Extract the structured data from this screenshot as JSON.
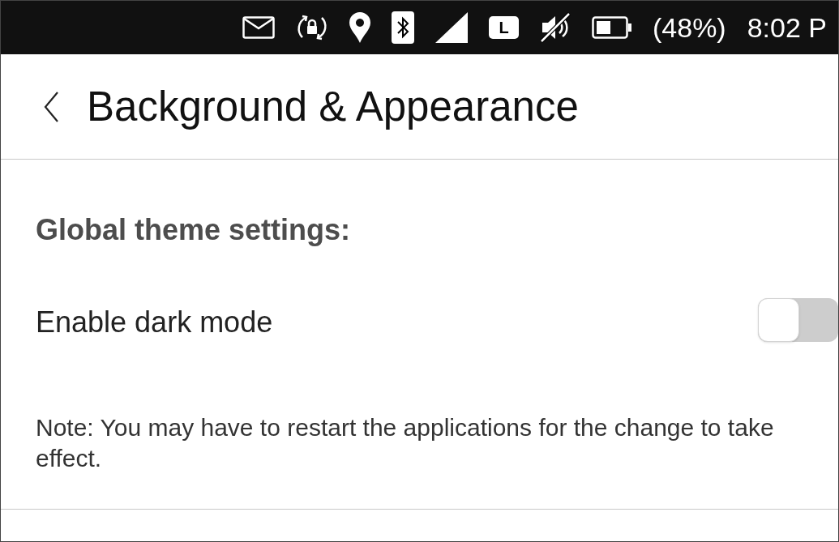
{
  "status_bar": {
    "keyboard_layout": "L",
    "battery_percent": "(48%)",
    "time": "8:02 P"
  },
  "header": {
    "title": "Background & Appearance"
  },
  "section": {
    "heading": "Global theme settings:",
    "settings": [
      {
        "kind": "switch",
        "label": "Enable dark mode",
        "on": false
      }
    ],
    "note": "Note: You may have to restart the applications for the change to take effect."
  }
}
